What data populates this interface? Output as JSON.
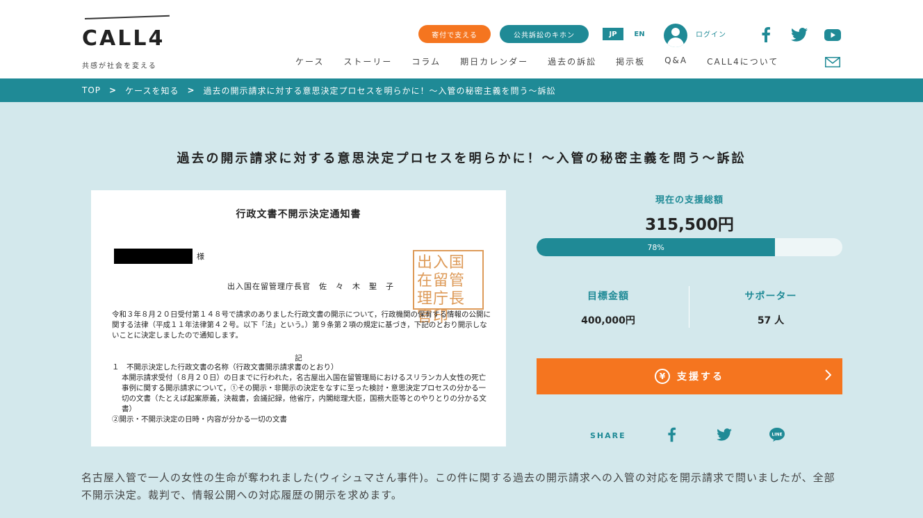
{
  "brand": {
    "logo_text": "CALL4",
    "tagline": "共感が社会を変える"
  },
  "header": {
    "donate_button": "寄付で支える",
    "basics_button": "公共訴訟のキホン",
    "lang_jp": "JP",
    "lang_en": "EN",
    "login": "ログイン",
    "social_icons": [
      "facebook-icon",
      "twitter-icon",
      "youtube-icon"
    ]
  },
  "nav": {
    "items": [
      "ケース",
      "ストーリー",
      "コラム",
      "期日カレンダー",
      "過去の訴訟",
      "掲示板",
      "Q&A",
      "CALL4について"
    ]
  },
  "breadcrumb": {
    "items": [
      "TOP",
      "ケースを知る",
      "過去の開示請求に対する意思決定プロセスを明らかに！〜入管の秘密主義を問う〜訴訟"
    ],
    "separator": ">"
  },
  "page_title": "過去の開示請求に対する意思決定プロセスを明らかに！〜入管の秘密主義を問う〜訴訟",
  "document": {
    "title": "行政文書不開示決定通知書",
    "salutation": "様",
    "sender": "出入国在留管理庁長官　佐　々　木　聖　子",
    "seal_text": "出入国在留管理庁長官印",
    "body": "令和３年８月２０日受付第１４８号で請求のありました行政文書の開示について，行政機関の保有する情報の公開に関する法律（平成１１年法律第４２号。以下「法」という。）第９条第２項の規定に基づき，下記のとおり開示しないことに決定しましたので通知します。",
    "ki": "記",
    "item_heading": "１　不開示決定した行政文書の名称（行政文書開示請求書のとおり）",
    "item_body": "本開示請求受付（８月２０日）の日までに行われた，名古屋出入国在留管理局におけるスリランカ人女性の死亡事例に関する開示請求について，①その開示・非開示の決定をなすに至った検討・意思決定プロセスの分かる一切の文書（たとえば起案原義，決裁書，会議記録，他省庁，内閣総理大臣，国務大臣等とのやりとりの分かる文書）",
    "item_body2": "②開示・不開示決定の日時・内容が分かる一切の文書"
  },
  "support": {
    "total_label": "現在の支援総額",
    "total_amount": "315,500円",
    "progress_percent": 78,
    "progress_label": "78%",
    "goal_label": "目標金額",
    "goal_value": "400,000円",
    "supporters_label": "サポーター",
    "supporters_value": "57 人",
    "support_button": "支援する",
    "yen_symbol": "¥"
  },
  "share": {
    "label": "SHARE",
    "icons": [
      "facebook-icon",
      "twitter-icon",
      "line-icon"
    ],
    "line_text": "LINE"
  },
  "description": "名古屋入管で一人の女性の生命が奪われました(ウィシュマさん事件)。この件に関する過去の開示請求への入管の対応を開示請求で問いましたが、全部不開示決定。裁判で、情報公開への対応履歴の開示を求めます。",
  "colors": {
    "teal": "#1f8a96",
    "orange": "#f5751f",
    "background": "#d3e8ec"
  }
}
